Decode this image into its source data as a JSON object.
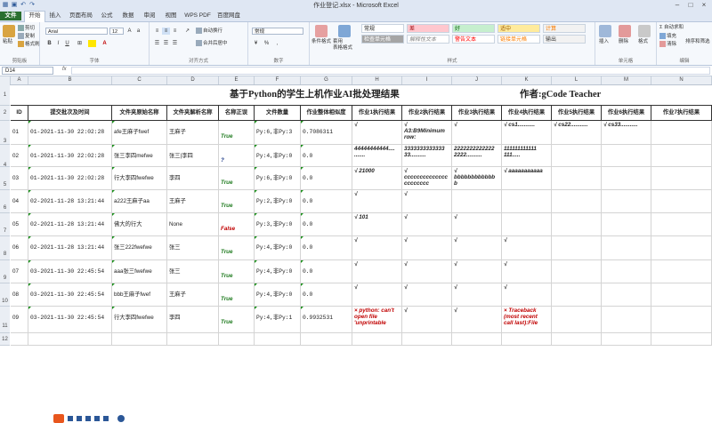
{
  "window": {
    "title": "作业登记.xlsx - Microsoft Excel"
  },
  "tabs": [
    {
      "label": "文件"
    },
    {
      "label": "开始"
    },
    {
      "label": "插入"
    },
    {
      "label": "页面布局"
    },
    {
      "label": "公式"
    },
    {
      "label": "数据"
    },
    {
      "label": "审阅"
    },
    {
      "label": "视图"
    },
    {
      "label": "WPS PDF"
    },
    {
      "label": "百度网盘"
    }
  ],
  "ribbon": {
    "clipboard": {
      "label": "剪贴板",
      "paste": "粘贴",
      "cut": "剪切",
      "copy": "复制",
      "format_painter": "格式刷"
    },
    "font": {
      "label": "字体",
      "font_name": "Arial",
      "font_size": "12",
      "bold": "B",
      "italic": "I",
      "underline": "U"
    },
    "alignment": {
      "label": "对齐方式",
      "wrap": "自动换行",
      "merge": "合并后居中"
    },
    "number": {
      "label": "数字",
      "format": "常规",
      "percent": "%",
      "comma": ","
    },
    "styles": {
      "label": "样式",
      "conditional": "条件格式",
      "table": "套用\n表格格式",
      "swatches": [
        "常规",
        "差",
        "好",
        "适中",
        "计算",
        "检查单元格",
        "解释性文本",
        "警告文本",
        "链接单元格",
        "输出"
      ]
    },
    "cells": {
      "label": "单元格",
      "insert": "插入",
      "delete": "删除",
      "format": "格式"
    },
    "editing": {
      "label": "编辑",
      "autosum": "自动求和",
      "fill": "填充",
      "clear": "清除",
      "sort": "排序和筛选"
    }
  },
  "formula_bar": {
    "name_box": "D14",
    "fx": "fx",
    "value": ""
  },
  "columns": [
    "A",
    "B",
    "C",
    "D",
    "E",
    "F",
    "G",
    "H",
    "I",
    "J",
    "K",
    "L",
    "M",
    "N"
  ],
  "rows": [
    "1",
    "2",
    "3",
    "4",
    "5",
    "6",
    "7",
    "8",
    "9",
    "10",
    "11",
    "12"
  ],
  "sheet": {
    "title": "基于Python的学生上机作业AI批处理结果",
    "author": "作者:gCode Teacher",
    "headers": [
      "ID",
      "提交批次及时间",
      "文件夹原始名称",
      "文件夹解析名称",
      "名称正误",
      "文件数量",
      "作业整体相似度",
      "作业1执行结果",
      "作业2执行结果",
      "作业3执行结果",
      "作业4执行结果",
      "作业5执行结果",
      "作业6执行结果",
      "作业7执行结果"
    ],
    "records": [
      {
        "id": "01",
        "batch": "01-2021-11-30 22:02:28",
        "orig": "afe王麻子fwef",
        "parsed": "王麻子",
        "ok": "True",
        "count": "Py:6,非Py:3",
        "sim": "0.7086311",
        "r1": "√",
        "r2": "√\nA3:B9Minimum\nrow:",
        "r3": "√",
        "r4": "√ cs1...........",
        "r5": "√ cs22...........",
        "r6": "√ cs33...........",
        "r7": ""
      },
      {
        "id": "02",
        "batch": "01-2021-11-30 22:02:28",
        "orig": "张三李四mefwe",
        "parsed": "张三|李四",
        "ok": "?",
        "count": "Py:4,非Py:0",
        "sim": "0.0",
        "r1": "44444444444....\n.......",
        "r2": "3333333333333\n33..........",
        "r3": "2222222222222\n2222..........",
        "r4": "111111111111\n111.....",
        "r5": "",
        "r6": "",
        "r7": ""
      },
      {
        "id": "03",
        "batch": "01-2021-11-30 22:02:28",
        "orig": "行大李四fwefwe",
        "parsed": "李四",
        "ok": "True",
        "count": "Py:6,非Py:0",
        "sim": "0.0",
        "r1": "√ 21000",
        "r2": "√\ncccccccccccccc\ncccccccc",
        "r3": "√\nbbbbbbbbbbbb\nb",
        "r4": "√ aaaaaaaaaaa",
        "r5": "",
        "r6": "",
        "r7": ""
      },
      {
        "id": "04",
        "batch": "02-2021-11-28 13:21:44",
        "orig": "a222王麻子aa",
        "parsed": "王麻子",
        "ok": "True",
        "count": "Py:2,非Py:0",
        "sim": "0.0",
        "r1": "√",
        "r2": "√",
        "r3": "",
        "r4": "",
        "r5": "",
        "r6": "",
        "r7": ""
      },
      {
        "id": "05",
        "batch": "02-2021-11-28 13:21:44",
        "orig": "佛大的行大",
        "parsed": "None",
        "ok": "False",
        "count": "Py:3,非Py:0",
        "sim": "0.0",
        "r1": "√ 101",
        "r2": "√",
        "r3": "√",
        "r4": "",
        "r5": "",
        "r6": "",
        "r7": ""
      },
      {
        "id": "06",
        "batch": "02-2021-11-28 13:21:44",
        "orig": "张三222fwefwe",
        "parsed": "张三",
        "ok": "True",
        "count": "Py:4,非Py:0",
        "sim": "0.0",
        "r1": "√",
        "r2": "√",
        "r3": "√",
        "r4": "√",
        "r5": "",
        "r6": "",
        "r7": ""
      },
      {
        "id": "07",
        "batch": "03-2021-11-30 22:45:54",
        "orig": "aaa张三fwefwe",
        "parsed": "张三",
        "ok": "True",
        "count": "Py:4,非Py:0",
        "sim": "0.0",
        "r1": "√",
        "r2": "√",
        "r3": "√",
        "r4": "√",
        "r5": "",
        "r6": "",
        "r7": ""
      },
      {
        "id": "08",
        "batch": "03-2021-11-30 22:45:54",
        "orig": "bbb王麻子fwef",
        "parsed": "王麻子",
        "ok": "True",
        "count": "Py:4,非Py:0",
        "sim": "0.0",
        "r1": "√",
        "r2": "√",
        "r3": "√",
        "r4": "√",
        "r5": "",
        "r6": "",
        "r7": ""
      },
      {
        "id": "09",
        "batch": "03-2021-11-30 22:45:54",
        "orig": "行大李四fwefwe",
        "parsed": "李四",
        "ok": "True",
        "count": "Py:4,非Py:1",
        "sim": "0.9932531",
        "r1": "× python: can't\nopen file\n'unprintable",
        "r2": "√",
        "r3": "√",
        "r4": "× Traceback\n(most recent\ncall last):File",
        "r5": "",
        "r6": "",
        "r7": ""
      }
    ]
  },
  "colors": {
    "accent": "#2a6f2f",
    "true": "#1d7a1d",
    "false": "#c00000",
    "unknown": "#1f3c88"
  }
}
